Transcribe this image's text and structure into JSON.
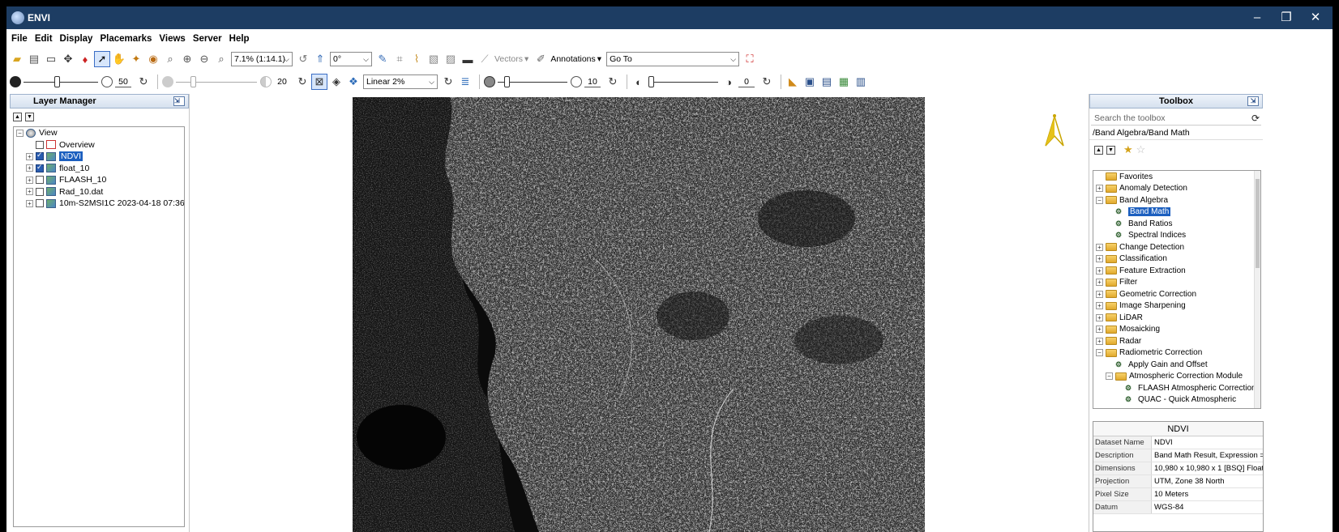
{
  "window": {
    "title": "ENVI"
  },
  "menu": [
    "File",
    "Edit",
    "Display",
    "Placemarks",
    "Views",
    "Server",
    "Help"
  ],
  "toolbar1": {
    "zoom_value": "7.1% (1:14.1)",
    "rotation_value": "0°",
    "vectors_label": "Vectors",
    "annotations_label": "Annotations",
    "goto_value": "Go To"
  },
  "toolbar2": {
    "brightness_value": "50",
    "contrast_value": "20",
    "stretch_value": "Linear 2%",
    "sharpen_value": "10",
    "transparency_value": "0",
    "brightness_level": 0.45,
    "contrast_level": 0.2,
    "sharpen_level": 0.1,
    "transparency_level": 0.0
  },
  "layer_manager": {
    "title": "Layer Manager",
    "root": "View",
    "items": [
      {
        "label": "Overview",
        "checked": false,
        "selected": false,
        "icon": "overview-icon"
      },
      {
        "label": "NDVI",
        "checked": true,
        "selected": true,
        "icon": "raster-icon"
      },
      {
        "label": "float_10",
        "checked": true,
        "selected": false,
        "icon": "raster-icon"
      },
      {
        "label": "FLAASH_10",
        "checked": false,
        "selected": false,
        "icon": "raster-icon"
      },
      {
        "label": "Rad_10.dat",
        "checked": false,
        "selected": false,
        "icon": "raster-icon"
      },
      {
        "label": "10m-S2MSI1C 2023-04-18 07:36",
        "checked": false,
        "selected": false,
        "icon": "raster-icon"
      }
    ]
  },
  "toolbox": {
    "title": "Toolbox",
    "search_placeholder": "Search the toolbox",
    "path": "/Band Algebra/Band Math",
    "tree": [
      {
        "label": "Favorites",
        "kind": "folder",
        "level": 0,
        "expander": ""
      },
      {
        "label": "Anomaly Detection",
        "kind": "folder",
        "level": 0,
        "expander": "+"
      },
      {
        "label": "Band Algebra",
        "kind": "folder",
        "level": 0,
        "expander": "−"
      },
      {
        "label": "Band Math",
        "kind": "tool",
        "level": 1,
        "selected": true
      },
      {
        "label": "Band Ratios",
        "kind": "tool",
        "level": 1
      },
      {
        "label": "Spectral Indices",
        "kind": "tool",
        "level": 1
      },
      {
        "label": "Change Detection",
        "kind": "folder",
        "level": 0,
        "expander": "+"
      },
      {
        "label": "Classification",
        "kind": "folder",
        "level": 0,
        "expander": "+"
      },
      {
        "label": "Feature Extraction",
        "kind": "folder",
        "level": 0,
        "expander": "+"
      },
      {
        "label": "Filter",
        "kind": "folder",
        "level": 0,
        "expander": "+"
      },
      {
        "label": "Geometric Correction",
        "kind": "folder",
        "level": 0,
        "expander": "+"
      },
      {
        "label": "Image Sharpening",
        "kind": "folder",
        "level": 0,
        "expander": "+"
      },
      {
        "label": "LiDAR",
        "kind": "folder",
        "level": 0,
        "expander": "+"
      },
      {
        "label": "Mosaicking",
        "kind": "folder",
        "level": 0,
        "expander": "+"
      },
      {
        "label": "Radar",
        "kind": "folder",
        "level": 0,
        "expander": "+"
      },
      {
        "label": "Radiometric Correction",
        "kind": "folder",
        "level": 0,
        "expander": "−"
      },
      {
        "label": "Apply Gain and Offset",
        "kind": "tool",
        "level": 1
      },
      {
        "label": "Atmospheric Correction Module",
        "kind": "folder",
        "level": 1,
        "expander": "−"
      },
      {
        "label": "FLAASH Atmospheric Correction",
        "kind": "tool",
        "level": 2
      },
      {
        "label": "QUAC - Quick Atmospheric",
        "kind": "tool",
        "level": 2
      }
    ]
  },
  "metadata": {
    "title": "NDVI",
    "rows": [
      {
        "key": "Dataset Name",
        "value": "NDVI"
      },
      {
        "key": "Description",
        "value": "Band Math Result, Expression ="
      },
      {
        "key": "Dimensions",
        "value": "10,980 x 10,980 x 1 [BSQ] Float"
      },
      {
        "key": "Projection",
        "value": "UTM, Zone 38 North"
      },
      {
        "key": "Pixel Size",
        "value": "10 Meters"
      },
      {
        "key": "Datum",
        "value": "WGS-84"
      }
    ]
  },
  "colors": {
    "titlebar": "#1d3d63",
    "selection": "#1c5fbf",
    "image_background": "#0d0d0d",
    "north_arrow": "#e6c21a"
  }
}
